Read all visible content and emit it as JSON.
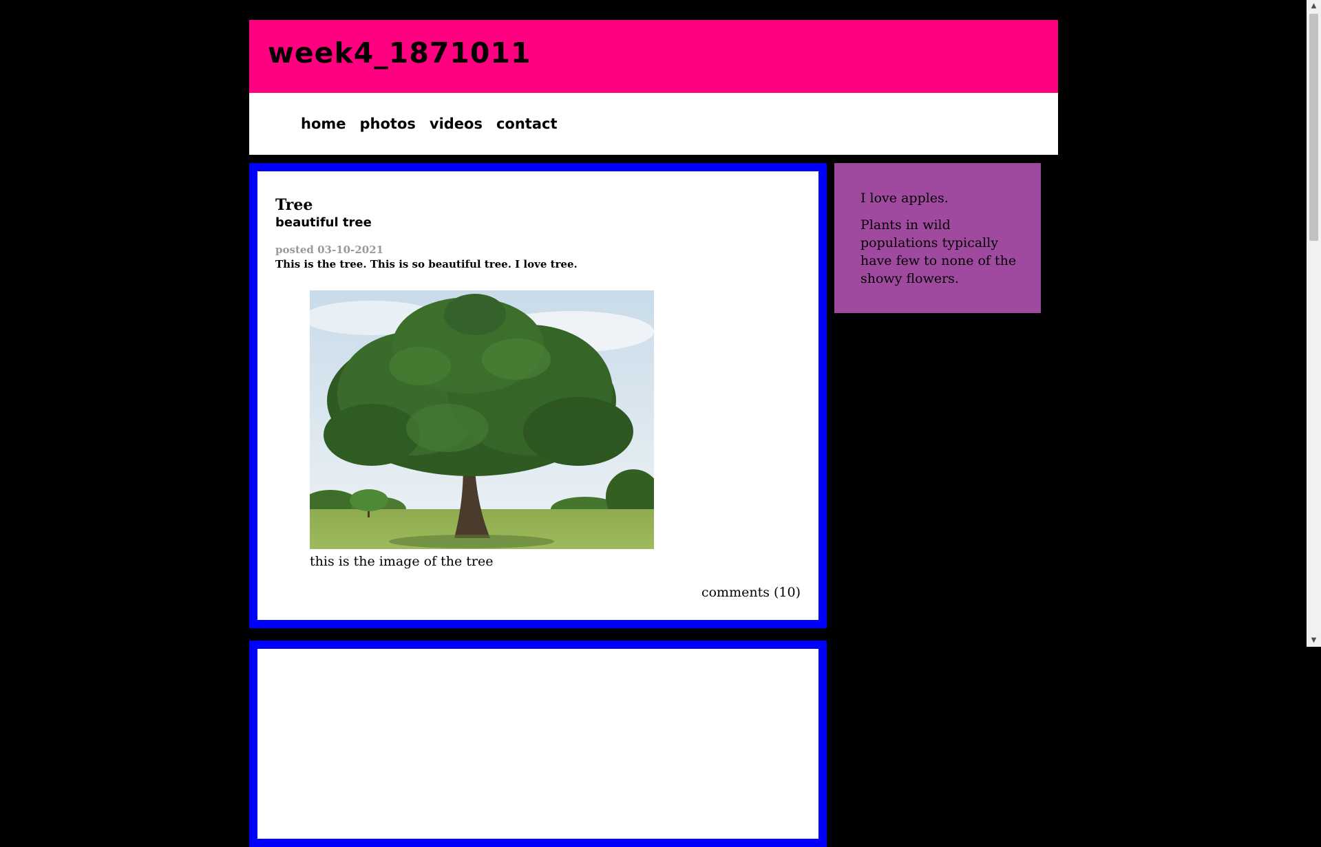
{
  "header": {
    "site_title": "week4_1871011"
  },
  "nav": {
    "items": [
      {
        "label": "home"
      },
      {
        "label": "photos"
      },
      {
        "label": "videos"
      },
      {
        "label": "contact"
      }
    ]
  },
  "post": {
    "title": "Tree",
    "subtitle": "beautiful tree",
    "date": "posted 03-10-2021",
    "body": "This is the tree. This is so beautiful tree. I love tree.",
    "image_caption": "this is the image of the tree",
    "comments": "comments (10)"
  },
  "sidebar": {
    "paragraphs": [
      "I love apples.",
      "Plants in wild populations typically have few to none of the showy flowers."
    ]
  },
  "colors": {
    "page_background": "#000000",
    "header_background": "#ff0080",
    "nav_background": "#ffffff",
    "post_border": "#0000ff",
    "sidebar_background": "#a04a9f",
    "date_text": "#999999"
  },
  "icons": {
    "scroll_up": "scroll-up-arrow-icon",
    "scroll_down": "scroll-down-arrow-icon"
  }
}
